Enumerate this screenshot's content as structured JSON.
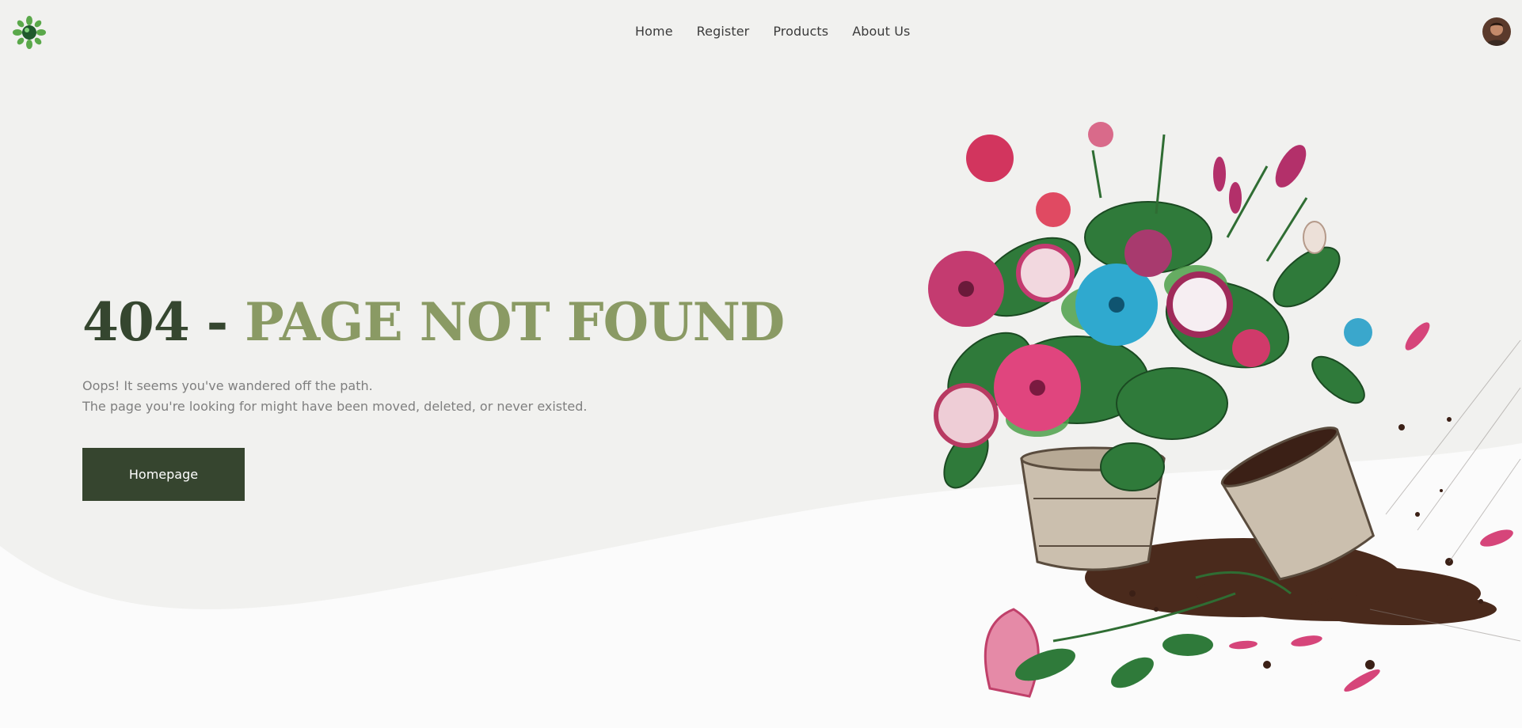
{
  "header": {
    "logo_icon": "leaf-globe-icon",
    "nav": [
      {
        "label": "Home"
      },
      {
        "label": "Register"
      },
      {
        "label": "Products"
      },
      {
        "label": "About Us"
      }
    ],
    "avatar_icon": "user-avatar-icon"
  },
  "hero": {
    "title_number": "404 - ",
    "title_accent": "PAGE NOT FOUND",
    "line1": "Oops! It seems you've wandered off the path.",
    "line2": "The page you're looking for might have been moved, deleted, or never existed.",
    "button_label": "Homepage"
  },
  "illustration": {
    "icon": "spilled-flower-pot-illustration"
  },
  "colors": {
    "background": "#f1f1ef",
    "wave": "#fbfbfb",
    "title_dark": "#35462f",
    "title_accent": "#8a9a64",
    "button": "#36452f",
    "body_text": "#7f7f7f"
  }
}
